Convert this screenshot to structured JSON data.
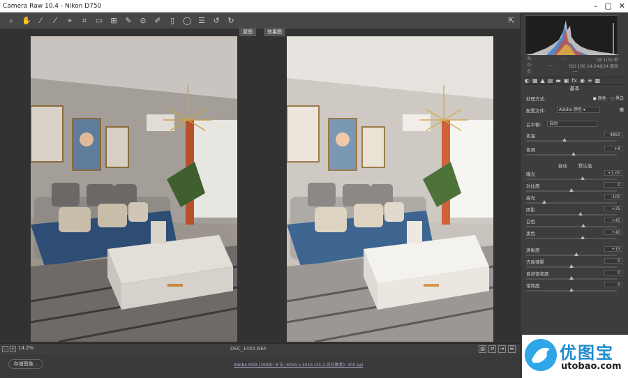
{
  "window": {
    "title": "Camera Raw 10.4 - Nikon D750"
  },
  "toolbar": {
    "tools": [
      "zoom-icon",
      "hand-icon",
      "white-balance-icon",
      "color-sampler-icon",
      "target-adjust-icon",
      "crop-icon",
      "straighten-icon",
      "transform-icon",
      "spot-removal-icon",
      "red-eye-icon",
      "adjustment-brush-icon",
      "graduated-filter-icon",
      "radial-filter-icon",
      "preferences-icon",
      "rotate-left-icon",
      "rotate-right-icon"
    ]
  },
  "preview": {
    "before_label": "原图",
    "after_label": "效果图"
  },
  "status": {
    "zoom": "14.2%",
    "filename": "DSC_1455.NEF"
  },
  "footer": {
    "save_button": "存储图像...",
    "info": "Adobe RGB (1998); 8 位; 6016 x 4016 (24.2 百万像素); 300 ppi"
  },
  "histogram": {
    "r_label": "R:",
    "g_label": "G:",
    "b_label": "B:",
    "r_val": "---",
    "g_val": "---",
    "b_val": "---",
    "exposure": "f/8   1/30 秒",
    "iso": "ISO 100   14-24@24 毫米"
  },
  "panel": {
    "title": "基本",
    "treatment_label": "处理方式:",
    "treatment_color": "颜色",
    "treatment_bw": "黑白",
    "profile_label": "配置文件:",
    "profile_value": "Adobe 颜色",
    "wb_label": "白平衡:",
    "wb_value": "自动",
    "auto_label": "自动",
    "default_label": "默认值",
    "sliders": [
      {
        "label": "色温",
        "value": "4850"
      },
      {
        "label": "色调",
        "value": "+8"
      },
      {
        "label": "曝光",
        "value": "+1.00"
      },
      {
        "label": "对比度",
        "value": "0"
      },
      {
        "label": "高光",
        "value": "-100"
      },
      {
        "label": "阴影",
        "value": "+35"
      },
      {
        "label": "白色",
        "value": "+45"
      },
      {
        "label": "黑色",
        "value": "+40"
      },
      {
        "label": "清晰度",
        "value": "+15"
      },
      {
        "label": "去除薄雾",
        "value": "0"
      },
      {
        "label": "自然饱和度",
        "value": "0"
      },
      {
        "label": "饱和度",
        "value": "0"
      }
    ]
  },
  "watermark": {
    "cn": "优图宝",
    "en": "utobao.com"
  }
}
